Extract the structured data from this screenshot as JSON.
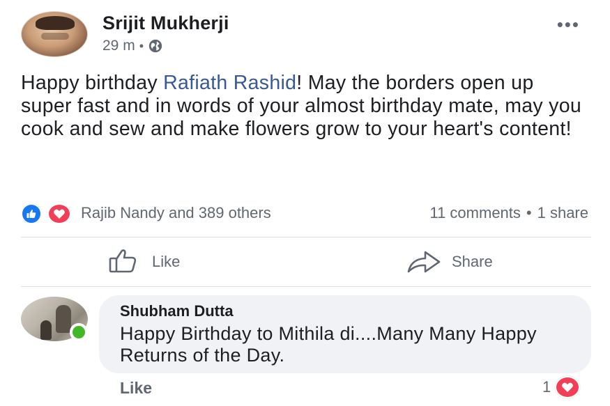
{
  "post": {
    "author": "Srijit Mukherji",
    "time": "29 m",
    "meta_separator": "•",
    "privacy_icon": "globe-icon",
    "more_icon": "•••",
    "text_before": "Happy birthday ",
    "mention": "Rafiath Rashid",
    "text_after": "! May the borders open up super fast and in words of your almost birthday mate, may you cook and sew and make flowers grow to your heart's content!"
  },
  "reactions": {
    "icons": [
      "like-icon",
      "love-icon"
    ],
    "reacted_by": "Rajib Nandy and 389 others",
    "comments": "11 comments",
    "separator": "•",
    "shares": "1 share"
  },
  "actions": {
    "like_label": "Like",
    "share_label": "Share"
  },
  "comment": {
    "author": "Shubham Dutta",
    "text": "Happy Birthday to Mithila di....Many Many Happy Returns of the Day.",
    "like_label": "Like",
    "reaction_count": "1",
    "reaction_icon": "love-icon",
    "online_status_color": "#42b72a"
  },
  "colors": {
    "mention": "#385898",
    "like_blue": "#1877f2",
    "love_red": "#f33e58",
    "secondary_text": "#606770",
    "bubble_bg": "#f0f2f5"
  }
}
